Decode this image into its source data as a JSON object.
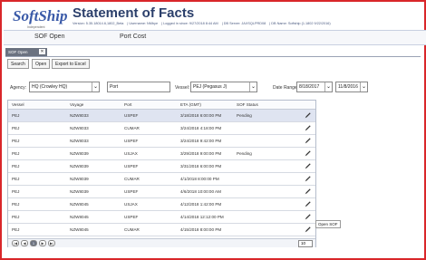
{
  "header": {
    "logo_text": "SoftShip",
    "logo_sub": "Independent",
    "title": "Statement of Facts",
    "version": "Version: 5.35.18014.6,1802_Beta",
    "username": "Username: NMbye",
    "logged_in": "Logged in since: 9/27/2018 8:44 AM",
    "db_server": "DB Server: JAXSQLPRD08",
    "db_name": "DB Name: Softship (1.1802 9/22/2016)"
  },
  "tabs": [
    "SOF Open",
    "Port Cost"
  ],
  "window_chip": {
    "label": "SOF Open",
    "close": "✕"
  },
  "toolbar": {
    "search": "Search",
    "open": "Open",
    "export": "Export to Excel"
  },
  "filters": {
    "agency_label": "Agency:",
    "agency_value": "HQ (Crowley HQ)",
    "port_value": "Port",
    "vessel_label": "Vessel:",
    "vessel_value": "PEJ (Pegasus J)",
    "date_label": "Date Range:",
    "date_from": "8/18/2017",
    "date_to": "11/8/2016"
  },
  "grid": {
    "columns": [
      "Vessel",
      "Voyage",
      "Port",
      "ETA (GMT)",
      "SOF Status"
    ],
    "rows": [
      [
        "PEJ",
        "NZW8033",
        "USPEF",
        "3/18/2018 6:00:00 PM",
        "Pending"
      ],
      [
        "PEJ",
        "NZW8033",
        "CUMAR",
        "3/24/2018 4:18:00 PM",
        ""
      ],
      [
        "PEJ",
        "NZW8033",
        "USPEF",
        "3/24/2018 9:42:00 PM",
        ""
      ],
      [
        "PEJ",
        "NZW8039",
        "USJAX",
        "3/29/2018 9:00:00 PM",
        "Pending"
      ],
      [
        "PEJ",
        "NZW8039",
        "USPEF",
        "3/31/2018 6:00:00 PM",
        ""
      ],
      [
        "PEJ",
        "NZW8039",
        "CUMAR",
        "4/1/2018 8:00:00 PM",
        ""
      ],
      [
        "PEJ",
        "NZW8039",
        "USPEF",
        "4/6/2018 10:00:00 AM",
        ""
      ],
      [
        "PEJ",
        "NZW8045",
        "USJAX",
        "4/12/2018 1:42:00 PM",
        ""
      ],
      [
        "PEJ",
        "NZW8045",
        "USPEF",
        "4/14/2018 12:12:00 PM",
        ""
      ],
      [
        "PEJ",
        "NZW8045",
        "CUMAR",
        "4/15/2018 8:00:00 PM",
        ""
      ]
    ],
    "tooltip": "Open SOF",
    "pager": {
      "first": "|◀",
      "prev": "◀",
      "page": "1",
      "next": "▶",
      "last": "▶|",
      "size": "10"
    }
  }
}
